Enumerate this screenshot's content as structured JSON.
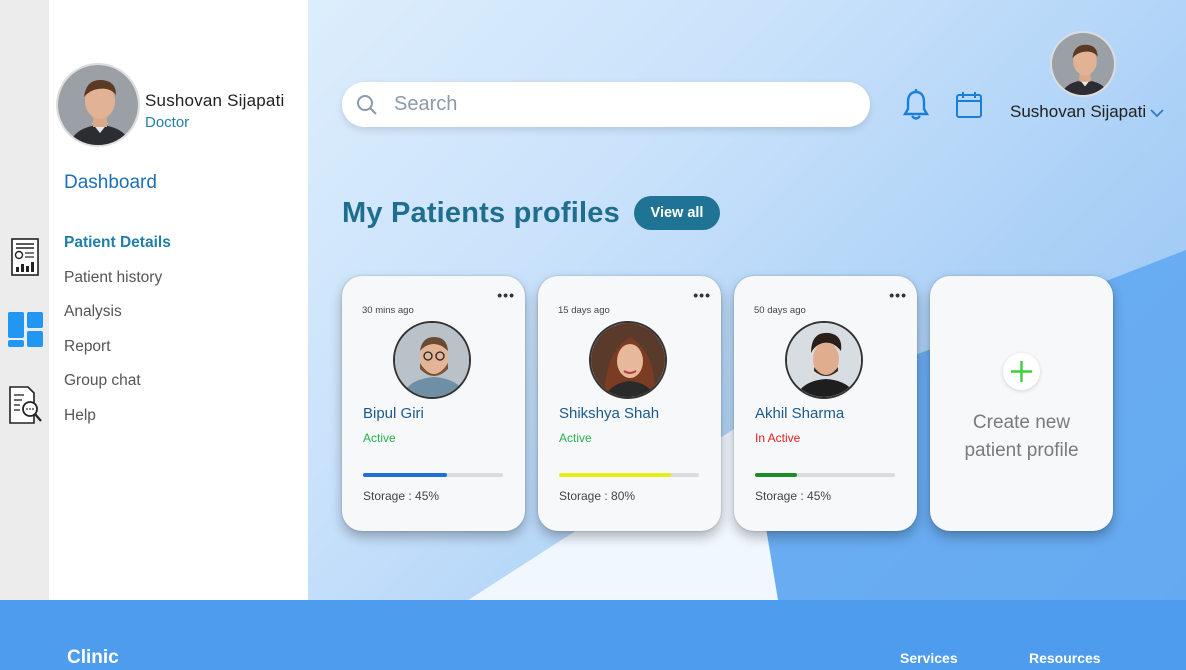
{
  "sidebar": {
    "doctor_name": "Sushovan Sijapati",
    "doctor_role": "Doctor",
    "dashboard_label": "Dashboard",
    "items": [
      {
        "label": "Patient Details",
        "active": true
      },
      {
        "label": "Patient history",
        "active": false
      },
      {
        "label": "Analysis",
        "active": false
      },
      {
        "label": "Report",
        "active": false
      },
      {
        "label": "Group chat",
        "active": false
      },
      {
        "label": "Help",
        "active": false
      }
    ]
  },
  "rail": {
    "icons": [
      "report-chart-icon",
      "dashboard-grid-icon",
      "document-search-icon"
    ]
  },
  "header": {
    "search_placeholder": "Search",
    "user_name": "Sushovan Sijapati",
    "icons": [
      "search-icon",
      "bell-icon",
      "calendar-icon",
      "chevron-down-icon"
    ]
  },
  "patients_section": {
    "title": "My Patients profiles",
    "view_all_label": "View all"
  },
  "patients": [
    {
      "time": "30 mins ago",
      "name": "Bipul Giri",
      "status": "Active",
      "status_color": "#22b14c",
      "storage_label": "Storage : 45%",
      "storage_pct": 0.6,
      "bar_color": "#1e6fd9"
    },
    {
      "time": "15 days ago",
      "name": "Shikshya Shah",
      "status": "Active",
      "status_color": "#22b14c",
      "storage_label": "Storage : 80%",
      "storage_pct": 0.8,
      "bar_color": "#e8ee1a"
    },
    {
      "time": "50 days ago",
      "name": "Akhil Sharma",
      "status": "In Active",
      "status_color": "#e02020",
      "storage_label": "Storage : 45%",
      "storage_pct": 0.3,
      "bar_color": "#1e8c28"
    }
  ],
  "create_card": {
    "line1": "Create new",
    "line2": "patient profile"
  },
  "footer": {
    "brand": "Clinic",
    "links": [
      "Services",
      "Resources"
    ]
  },
  "colors": {
    "accent": "#1f7495",
    "footer": "#4d9cee",
    "title": "#1f6e8e"
  }
}
